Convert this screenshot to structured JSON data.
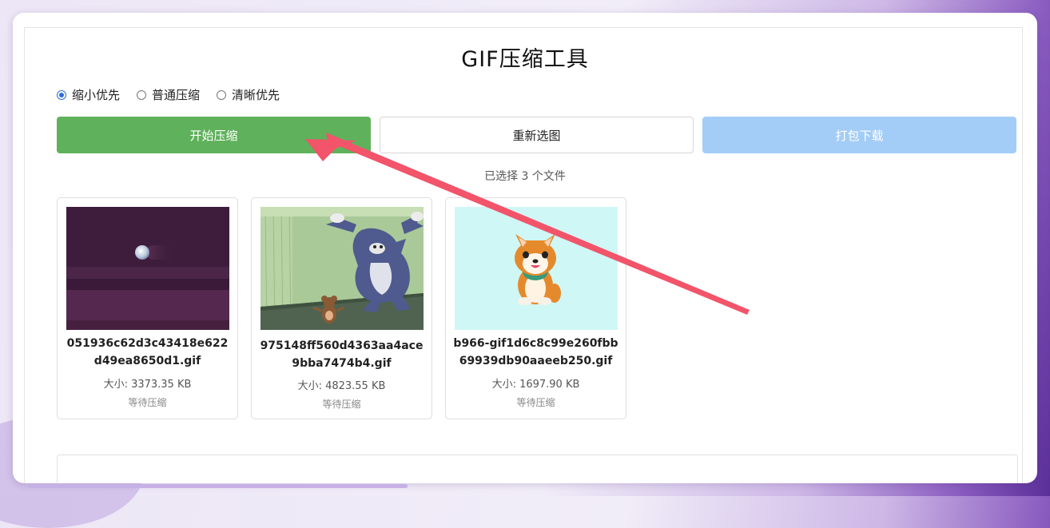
{
  "title": "GIF压缩工具",
  "modes": [
    {
      "label": "缩小优先",
      "selected": true
    },
    {
      "label": "普通压缩",
      "selected": false
    },
    {
      "label": "清晰优先",
      "selected": false
    }
  ],
  "buttons": {
    "start": "开始压缩",
    "reselect": "重新选图",
    "download": "打包下载"
  },
  "selected_text": "已选择 3 个文件",
  "files": [
    {
      "name": "051936c62d3c43418e622d49ea8650d1.gif",
      "size": "大小: 3373.35 KB",
      "status": "等待压缩"
    },
    {
      "name": "975148ff560d4363aa4ace9bba7474b4.gif",
      "size": "大小: 4823.55 KB",
      "status": "等待压缩"
    },
    {
      "name": "b966-gif1d6c8c99e260fbb69939db90aaeeb250.gif",
      "size": "大小: 1697.90 KB",
      "status": "等待压缩"
    }
  ],
  "colors": {
    "start_button": "#5fb15b",
    "download_button": "#a3cdf7",
    "radio_accent": "#2a6fdb",
    "arrow": "#f2546a"
  }
}
